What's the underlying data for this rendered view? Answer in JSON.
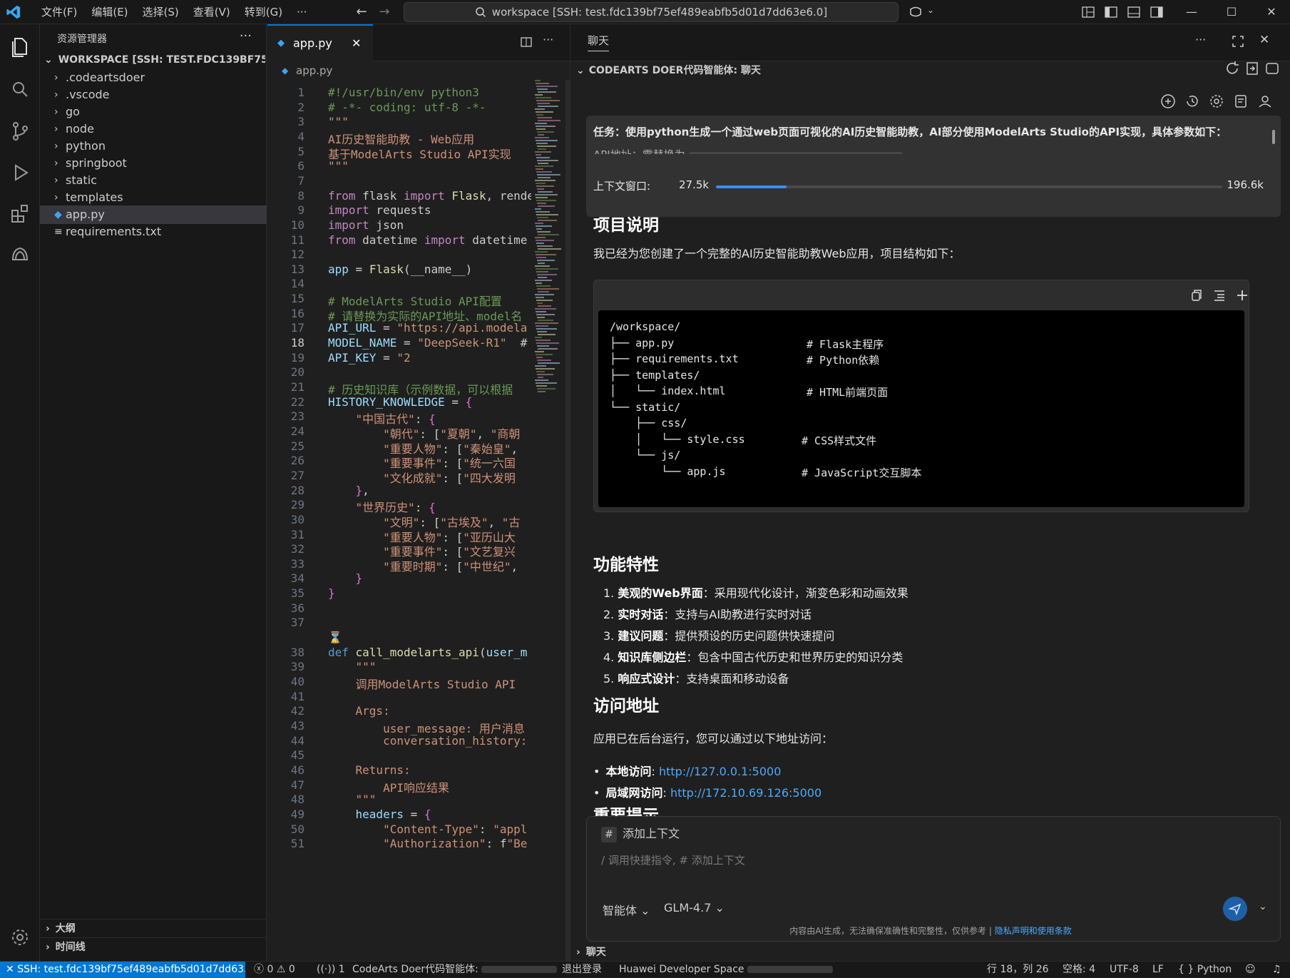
{
  "titlebar": {
    "menu": [
      "文件(F)",
      "编辑(E)",
      "选择(S)",
      "查看(V)",
      "转到(G)",
      "···"
    ],
    "command_center": "workspace [SSH: test.fdc139bf75ef489eabfb5d01d7dd63e6.0]"
  },
  "sidebar": {
    "header": "资源管理器",
    "workspace": "WORKSPACE [SSH: TEST.FDC139BF75EF489...",
    "items": [
      {
        "label": ".codeartsdoer",
        "type": "folder"
      },
      {
        "label": ".vscode",
        "type": "folder"
      },
      {
        "label": "go",
        "type": "folder"
      },
      {
        "label": "node",
        "type": "folder"
      },
      {
        "label": "python",
        "type": "folder"
      },
      {
        "label": "springboot",
        "type": "folder"
      },
      {
        "label": "static",
        "type": "folder"
      },
      {
        "label": "templates",
        "type": "folder"
      },
      {
        "label": "app.py",
        "type": "python-file",
        "selected": true
      },
      {
        "label": "requirements.txt",
        "type": "text-file"
      }
    ],
    "outline": "大纲",
    "timeline": "时间线"
  },
  "editor": {
    "tab": "app.py",
    "breadcrumb": "app.py",
    "current_line": 18,
    "lines": [
      {
        "n": "1",
        "t": "#!/usr/bin/env python3"
      },
      {
        "n": "2",
        "t": "# -*- coding: utf-8 -*-"
      },
      {
        "n": "3",
        "t": "\"\"\""
      },
      {
        "n": "4",
        "t": "AI历史智能助教 - Web应用"
      },
      {
        "n": "5",
        "t": "基于ModelArts Studio API实现"
      },
      {
        "n": "6",
        "t": "\"\"\""
      },
      {
        "n": "7",
        "t": ""
      },
      {
        "n": "8",
        "t": "from flask import Flask, rende"
      },
      {
        "n": "9",
        "t": "import requests"
      },
      {
        "n": "10",
        "t": "import json"
      },
      {
        "n": "11",
        "t": "from datetime import datetime"
      },
      {
        "n": "12",
        "t": ""
      },
      {
        "n": "13",
        "t": "app = Flask(__name__)"
      },
      {
        "n": "14",
        "t": ""
      },
      {
        "n": "15",
        "t": "# ModelArts Studio API配置"
      },
      {
        "n": "16",
        "t": "# 请替换为实际的API地址、model名"
      },
      {
        "n": "17",
        "t": "API_URL = \"https://api.modela"
      },
      {
        "n": "18",
        "t": "MODEL_NAME = \"DeepSeek-R1\"  #"
      },
      {
        "n": "19",
        "t": "API_KEY = \"2"
      },
      {
        "n": "20",
        "t": ""
      },
      {
        "n": "21",
        "t": "# 历史知识库（示例数据，可以根据"
      },
      {
        "n": "22",
        "t": "HISTORY_KNOWLEDGE = {"
      },
      {
        "n": "23",
        "t": "    \"中国古代\": {"
      },
      {
        "n": "24",
        "t": "        \"朝代\": [\"夏朝\", \"商朝"
      },
      {
        "n": "25",
        "t": "        \"重要人物\": [\"秦始皇\","
      },
      {
        "n": "26",
        "t": "        \"重要事件\": [\"统一六国"
      },
      {
        "n": "27",
        "t": "        \"文化成就\": [\"四大发明"
      },
      {
        "n": "28",
        "t": "    },"
      },
      {
        "n": "29",
        "t": "    \"世界历史\": {"
      },
      {
        "n": "30",
        "t": "        \"文明\": [\"古埃及\", \"古"
      },
      {
        "n": "31",
        "t": "        \"重要人物\": [\"亚历山大"
      },
      {
        "n": "32",
        "t": "        \"重要事件\": [\"文艺复兴"
      },
      {
        "n": "33",
        "t": "        \"重要时期\": [\"中世纪\","
      },
      {
        "n": "34",
        "t": "    }"
      },
      {
        "n": "35",
        "t": "}"
      },
      {
        "n": "36",
        "t": ""
      },
      {
        "n": "37",
        "t": ""
      },
      {
        "n": "",
        "t": "⌛"
      },
      {
        "n": "38",
        "t": "def call_modelarts_api(user_m"
      },
      {
        "n": "39",
        "t": "    \"\"\""
      },
      {
        "n": "40",
        "t": "    调用ModelArts Studio API"
      },
      {
        "n": "41",
        "t": ""
      },
      {
        "n": "42",
        "t": "    Args:"
      },
      {
        "n": "43",
        "t": "        user_message: 用户消息"
      },
      {
        "n": "44",
        "t": "        conversation_history:"
      },
      {
        "n": "45",
        "t": ""
      },
      {
        "n": "46",
        "t": "    Returns:"
      },
      {
        "n": "47",
        "t": "        API响应结果"
      },
      {
        "n": "48",
        "t": "    \"\"\""
      },
      {
        "n": "49",
        "t": "    headers = {"
      },
      {
        "n": "50",
        "t": "        \"Content-Type\": \"appl"
      },
      {
        "n": "51",
        "t": "        \"Authorization\": f\"Be"
      }
    ]
  },
  "chat": {
    "tab_title": "聊天",
    "section_title": "CODEARTS DOER代码智能体: 聊天",
    "task_line1": "任务：使用python生成一个通过web页面可视化的AI历史智能助教，AI部分使用ModelArts Studio的API实现，具体参数如下：",
    "task_line2": "API地址：需替换为",
    "context_label": "上下文窗口:",
    "context_used": "27.5k",
    "context_max": "196.6k",
    "context_fraction": 0.14,
    "h_project": "项目说明",
    "p_project": "我已经为您创建了一个完整的AI历史智能助教Web应用，项目结构如下：",
    "tree": [
      {
        "t": "/workspace/",
        "c": ""
      },
      {
        "t": "├── app.py",
        "c": "# Flask主程序"
      },
      {
        "t": "├── requirements.txt",
        "c": "# Python依赖"
      },
      {
        "t": "├── templates/",
        "c": ""
      },
      {
        "t": "│   └── index.html",
        "c": "# HTML前端页面"
      },
      {
        "t": "└── static/",
        "c": ""
      },
      {
        "t": "    ├── css/",
        "c": ""
      },
      {
        "t": "    │   └── style.css",
        "c": "# CSS样式文件"
      },
      {
        "t": "    └── js/",
        "c": ""
      },
      {
        "t": "        └── app.js",
        "c": "# JavaScript交互脚本"
      }
    ],
    "h_features": "功能特性",
    "features": [
      {
        "b": "美观的Web界面",
        "t": "：采用现代化设计，渐变色彩和动画效果"
      },
      {
        "b": "实时对话",
        "t": "：支持与AI助教进行实时对话"
      },
      {
        "b": "建议问题",
        "t": "：提供预设的历史问题供快速提问"
      },
      {
        "b": "知识库侧边栏",
        "t": "：包含中国古代历史和世界历史的知识分类"
      },
      {
        "b": "响应式设计",
        "t": "：支持桌面和移动设备"
      }
    ],
    "h_access": "访问地址",
    "p_access": "应用已在后台运行，您可以通过以下地址访问：",
    "access": [
      {
        "b": "本地访问",
        "sep": ": ",
        "url": "http://127.0.0.1:5000"
      },
      {
        "b": "局域网访问",
        "sep": ": ",
        "url": "http://172.10.69.126:5000"
      }
    ],
    "h_notice": "重要提示",
    "add_context": "添加上下文",
    "placeholder": "/ 调用快捷指令, # 添加上下文",
    "mode": "智能体",
    "model": "GLM-4.7",
    "disclaimer": "内容由AI生成，无法确保准确性和完整性，仅供参考",
    "disclaimer_link": "隐私声明和使用条款",
    "footer": "聊天"
  },
  "statusbar": {
    "remote": "SSH: test.fdc139bf75ef489eabfb5d01d7dd63...",
    "errors": "0",
    "warnings": "0",
    "ports": "1",
    "agent": "CodeArts Doer代码智能体:",
    "logout": "退出登录",
    "space": "Huawei Developer Space",
    "position": "行 18，列 26",
    "spaces": "空格: 4",
    "encoding": "UTF-8",
    "eol": "LF",
    "language": "Python"
  },
  "colors": {
    "accent": "#0078d4",
    "link": "#4daafc",
    "background": "#1f1f1f"
  }
}
